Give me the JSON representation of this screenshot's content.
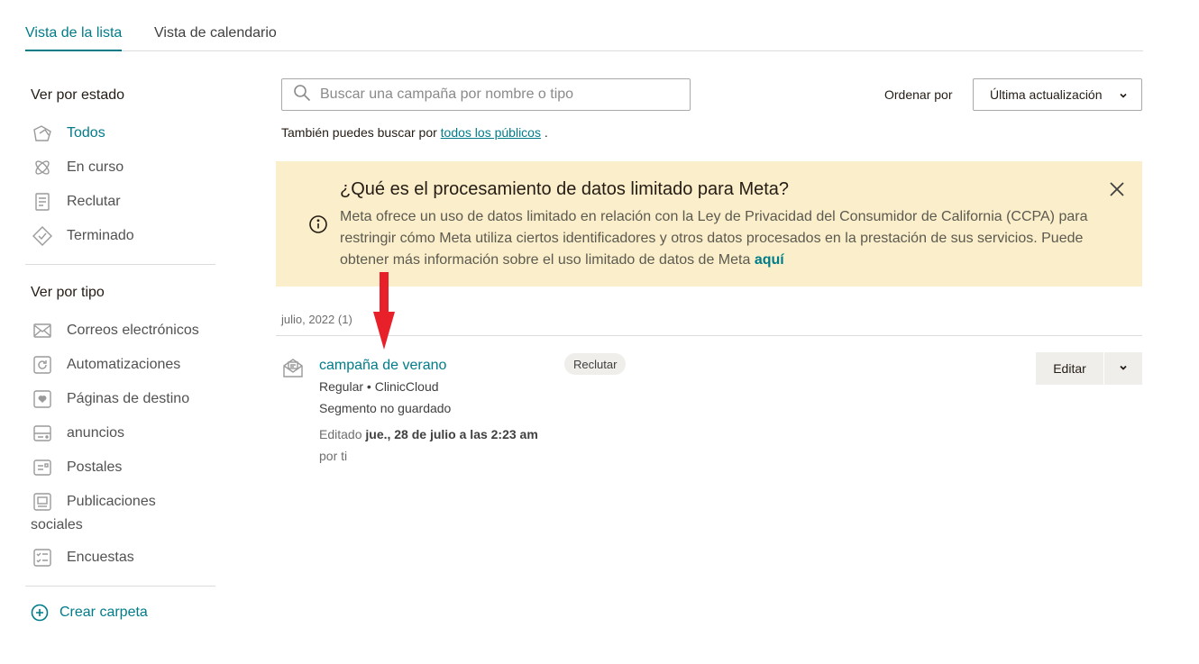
{
  "tabs": [
    {
      "label": "Vista de la lista",
      "active": true
    },
    {
      "label": "Vista de calendario",
      "active": false
    }
  ],
  "sidebar": {
    "status_heading": "Ver por estado",
    "status_items": [
      {
        "label": "Todos",
        "icon": "all-campaigns-icon",
        "active": true
      },
      {
        "label": "En curso",
        "icon": "ongoing-icon"
      },
      {
        "label": "Reclutar",
        "icon": "draft-icon"
      },
      {
        "label": "Terminado",
        "icon": "completed-icon"
      }
    ],
    "type_heading": "Ver por tipo",
    "type_items": [
      {
        "label": "Correos electrónicos",
        "icon": "email-icon"
      },
      {
        "label": "Automatizaciones",
        "icon": "automation-icon"
      },
      {
        "label": "Páginas de destino",
        "icon": "landing-page-icon"
      },
      {
        "label": "anuncios",
        "icon": "ads-icon"
      },
      {
        "label": "Postales",
        "icon": "postcard-icon"
      },
      {
        "label": "Publicaciones sociales",
        "icon": "social-post-icon"
      },
      {
        "label": "Encuestas",
        "icon": "survey-icon"
      }
    ],
    "create_folder": "Crear carpeta"
  },
  "search": {
    "placeholder": "Buscar una campaña por nombre o tipo",
    "value": ""
  },
  "sort": {
    "label": "Ordenar por",
    "selected": "Última actualización"
  },
  "also_search": {
    "prefix": "También puedes buscar por",
    "link": "todos los públicos",
    "suffix": "."
  },
  "banner": {
    "title": "¿Qué es el procesamiento de datos limitado para Meta?",
    "text": "Meta ofrece un uso de datos limitado en relación con la Ley de Privacidad del Consumidor de California (CCPA) para restringir cómo Meta utiliza ciertos identificadores y otros datos procesados en la prestación de sus servicios. Puede obtener más información sobre el uso limitado de datos de Meta",
    "link": "aquí"
  },
  "group": {
    "label": "julio, 2022 (1)"
  },
  "campaign": {
    "name": "campaña de verano",
    "type_line": "Regular • ClinicCloud",
    "segment": "Segmento no guardado",
    "edited_prefix": "Editado",
    "edited_date": "jue., 28 de julio a las 2:23 am",
    "by": "por ti",
    "status": "Reclutar",
    "edit_label": "Editar"
  },
  "colors": {
    "accent": "#007c89",
    "banner_bg": "#fbeeca",
    "annotation": "#e8202a"
  }
}
